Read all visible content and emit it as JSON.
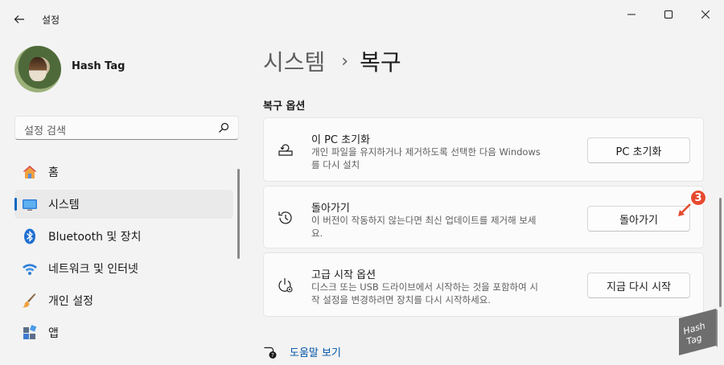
{
  "window": {
    "title": "설정"
  },
  "profile": {
    "name": "Hash Tag"
  },
  "search": {
    "placeholder": "설정 검색"
  },
  "sidebar": {
    "items": [
      {
        "label": "홈",
        "icon": "home-icon"
      },
      {
        "label": "시스템",
        "icon": "system-icon",
        "active": true
      },
      {
        "label": "Bluetooth 및 장치",
        "icon": "bluetooth-icon"
      },
      {
        "label": "네트워크 및 인터넷",
        "icon": "network-icon"
      },
      {
        "label": "개인 설정",
        "icon": "personalization-icon"
      },
      {
        "label": "앱",
        "icon": "apps-icon"
      }
    ]
  },
  "breadcrumb": {
    "parent": "시스템",
    "separator": "›",
    "current": "복구"
  },
  "recovery": {
    "section_title": "복구 옵션",
    "options": [
      {
        "title": "이 PC 초기화",
        "desc_line1": "개인 파일을 유지하거나 제거하도록 선택한 다음 Windows",
        "desc_line2": "를 다시 설치",
        "button": "PC 초기화",
        "icon": "reset-pc-icon"
      },
      {
        "title": "돌아가기",
        "desc_line1": "이 버전이 작동하지 않는다면 최신 업데이트를 제거해 보세",
        "desc_line2": "요.",
        "button": "돌아가기",
        "icon": "go-back-icon"
      },
      {
        "title": "고급 시작 옵션",
        "desc_line1": "디스크 또는 USB 드라이브에서 시작하는 것을 포함하여 시",
        "desc_line2": "작 설정을 변경하려면 장치를 다시 시작하세요.",
        "button": "지금 다시 시작",
        "icon": "advanced-startup-icon"
      }
    ]
  },
  "annotation": {
    "badge": "3"
  },
  "help": {
    "label": "도움말 보기"
  },
  "watermark": {
    "text_line1": "Hash",
    "text_line2": "Tag"
  },
  "colors": {
    "accent": "#0067c0",
    "link": "#0054a6",
    "badge": "#e64a2e"
  }
}
